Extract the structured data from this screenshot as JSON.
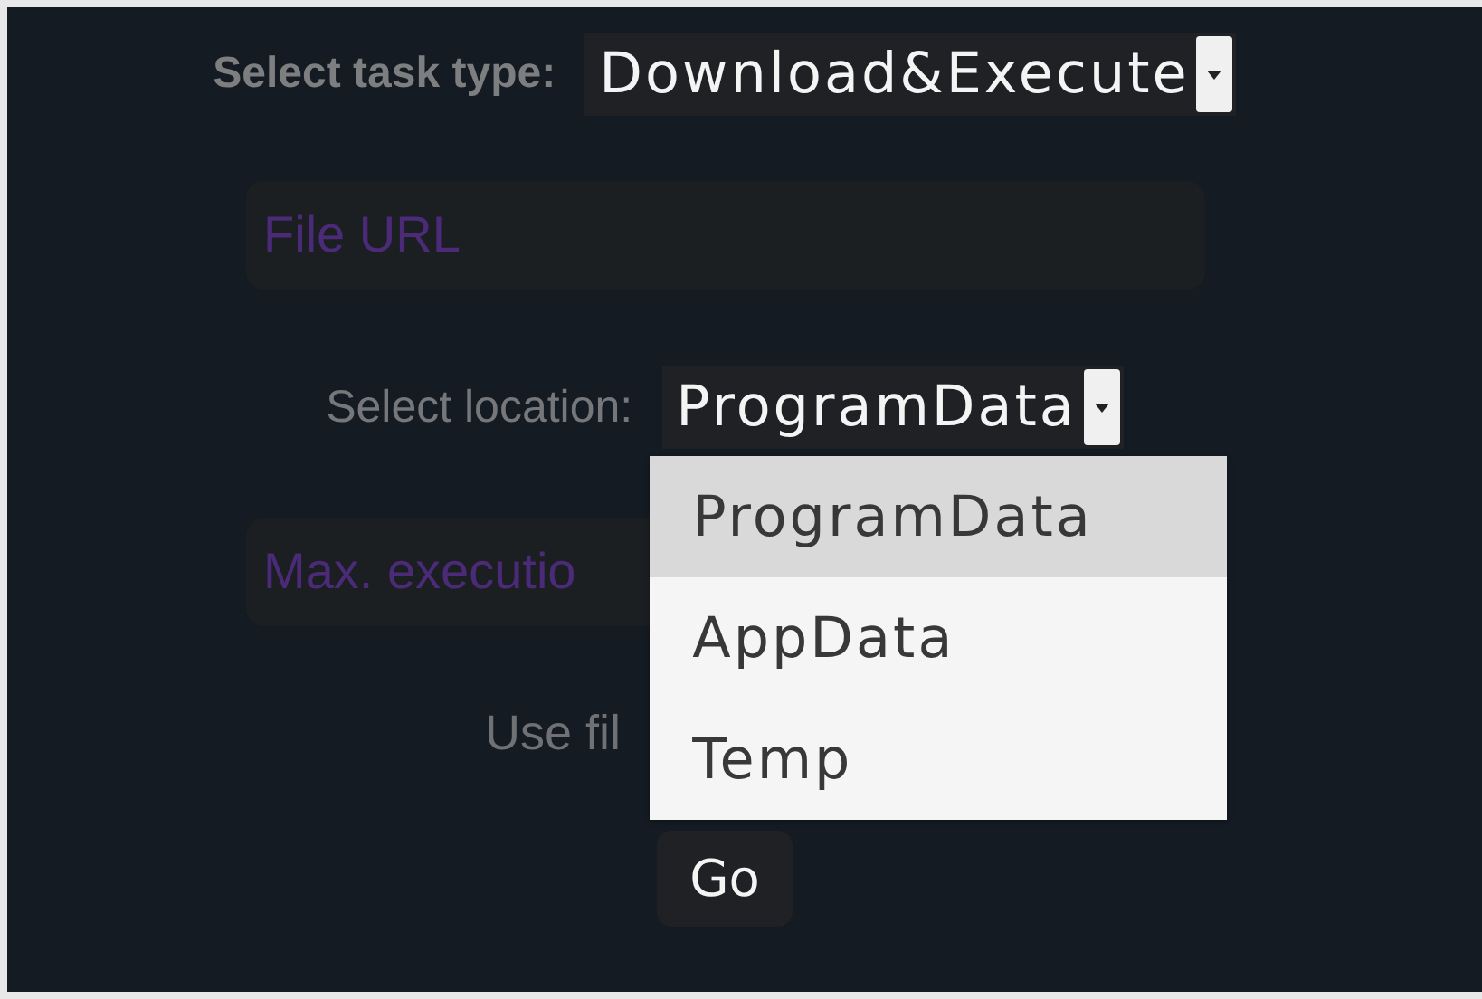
{
  "task_type": {
    "label": "Select task type:",
    "value": "Download&Execute"
  },
  "file_url": {
    "placeholder": "File URL"
  },
  "location": {
    "label": "Select location:",
    "value": "ProgramData",
    "expanded": true,
    "options": [
      {
        "label": "ProgramData",
        "selected": true
      },
      {
        "label": "AppData",
        "selected": false
      },
      {
        "label": "Temp",
        "selected": false
      }
    ]
  },
  "max_execution": {
    "placeholder": "Max. executio"
  },
  "use_file": {
    "label": "Use fil"
  },
  "go_button": {
    "label": "Go"
  }
}
